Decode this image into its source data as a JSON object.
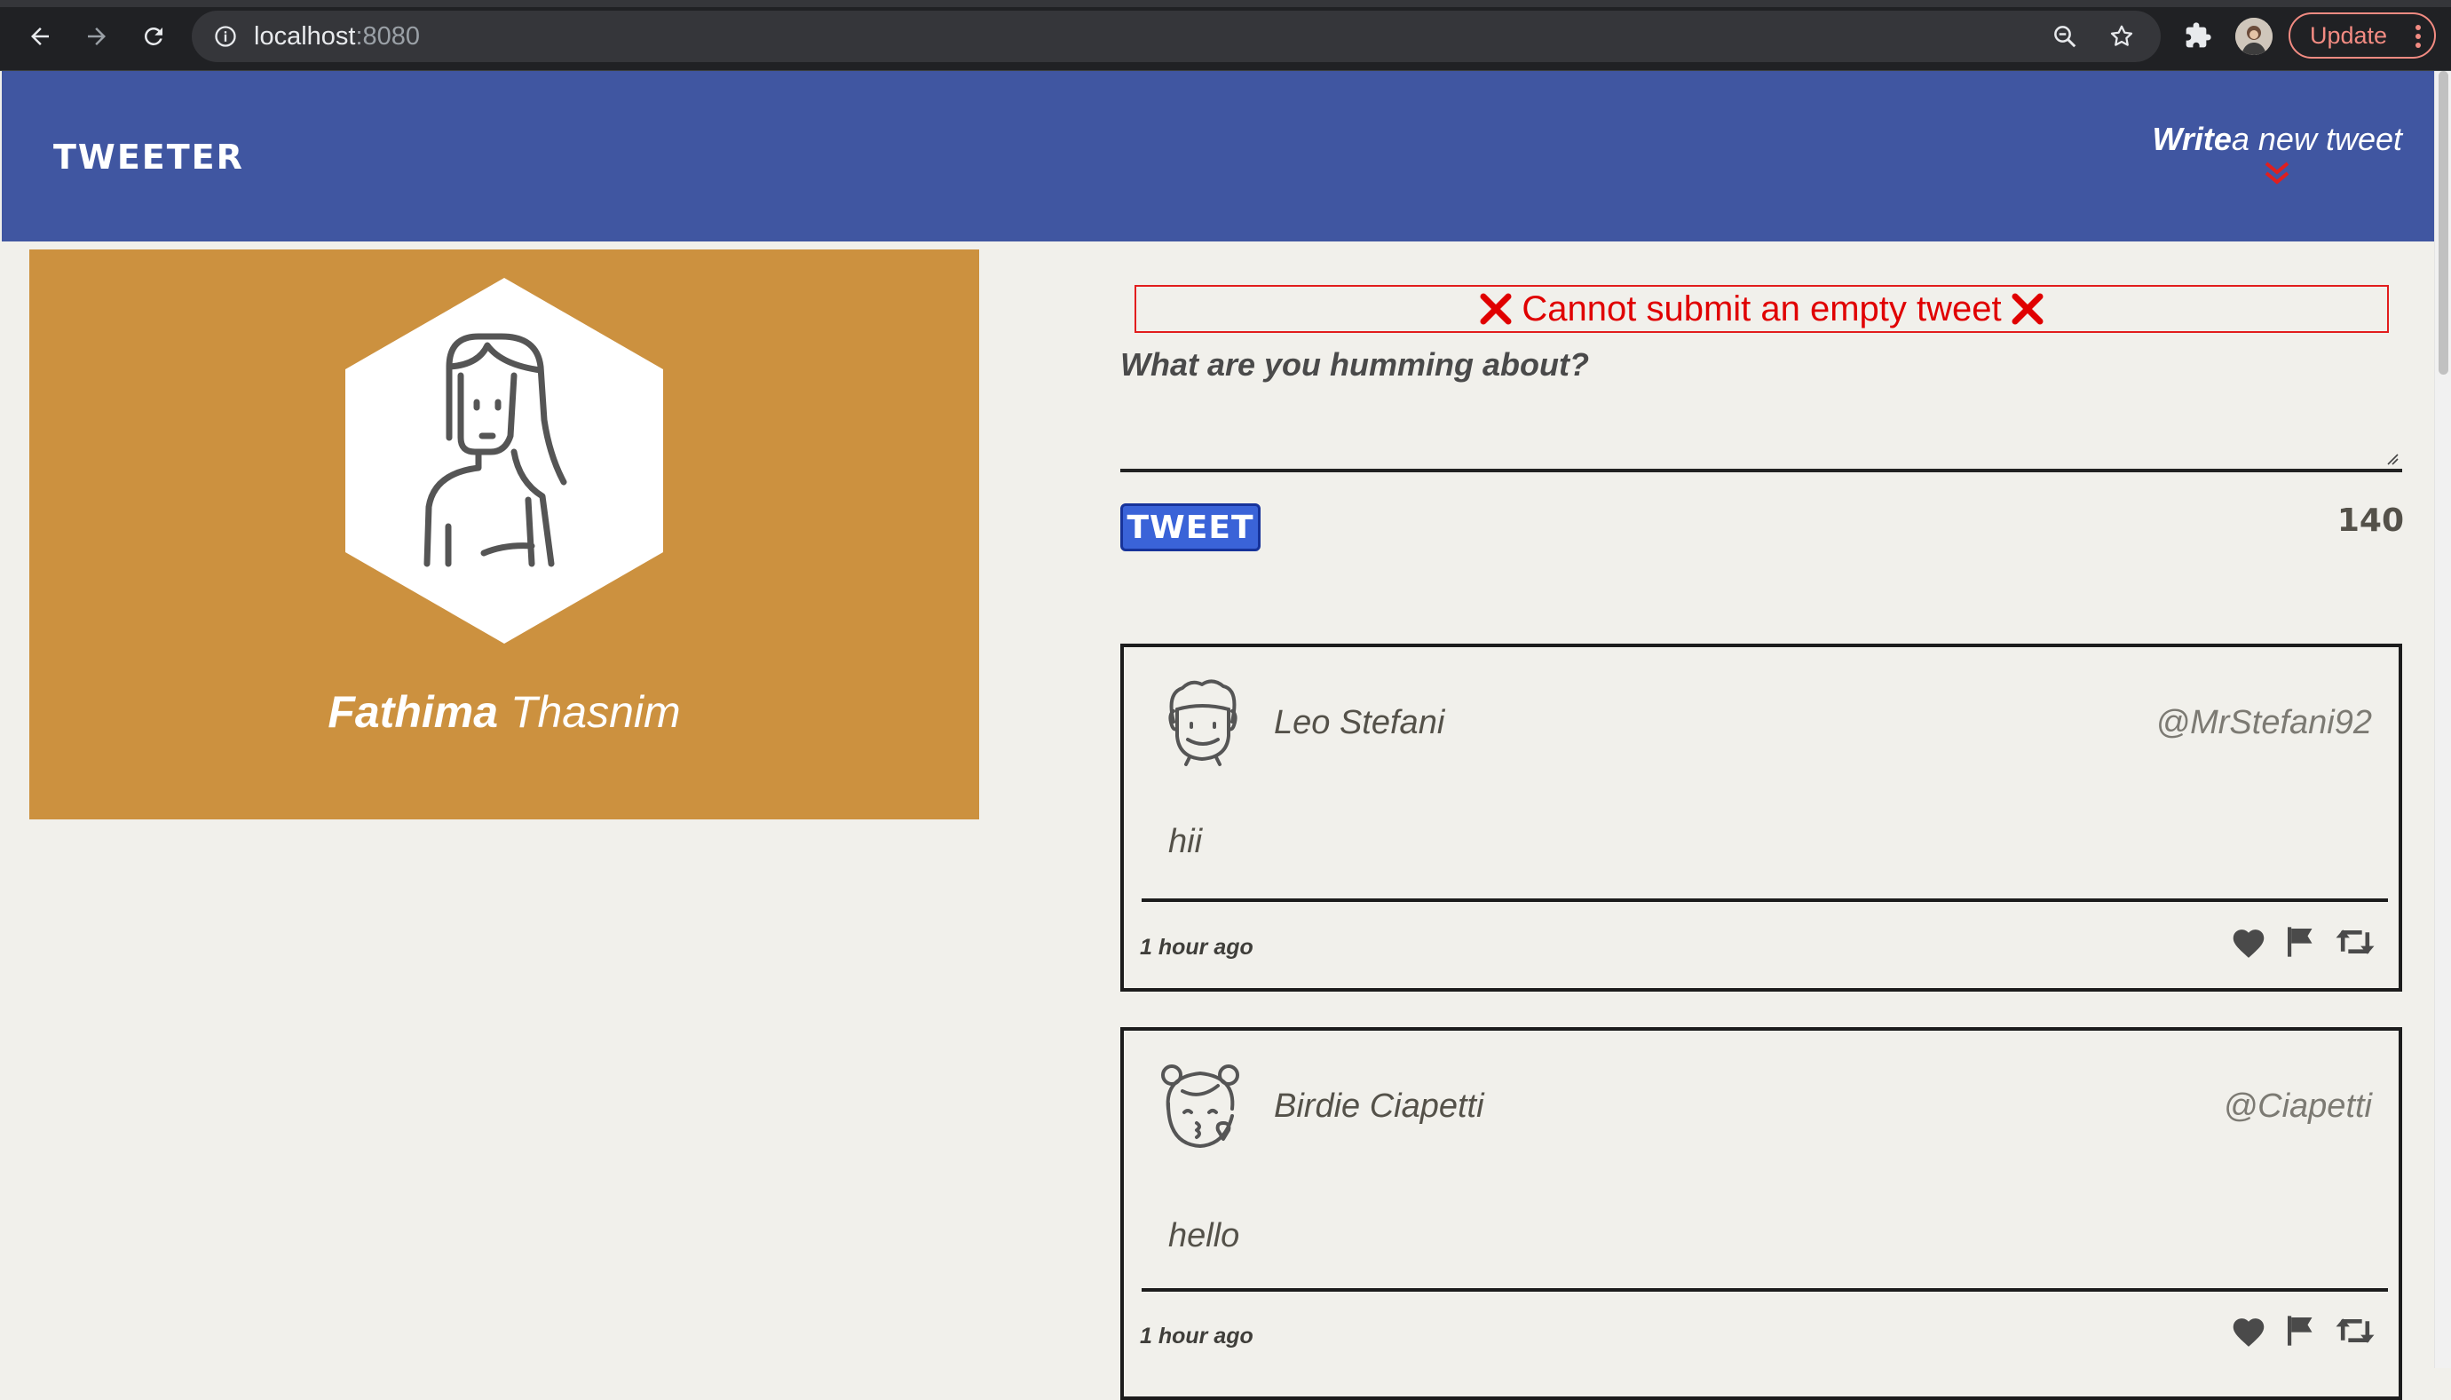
{
  "browser": {
    "url_host": "localhost",
    "url_port": ":8080",
    "update_label": "Update"
  },
  "header": {
    "brand": "TWEETER",
    "compose_bold": "Write",
    "compose_rest": "a new tweet"
  },
  "profile": {
    "first_name": "Fathima",
    "last_name": "Thasnim",
    "card_color": "#cc913f"
  },
  "compose": {
    "error": "Cannot submit an empty tweet",
    "prompt": "What are you humming about?",
    "input_value": "",
    "button_label": "TWEET",
    "char_counter": "140"
  },
  "tweets": [
    {
      "name": "Leo Stefani",
      "handle": "@MrStefani92",
      "body": "hii",
      "time": "1 hour ago",
      "avatar_icon": "boy-avatar-icon"
    },
    {
      "name": "Birdie Ciapetti",
      "handle": "@Ciapetti",
      "body": "hello",
      "time": "1 hour ago",
      "avatar_icon": "girl-avatar-icon"
    }
  ],
  "colors": {
    "header_bg": "#4056a1",
    "page_bg": "#f1f0eb",
    "error_red": "#e00000",
    "tweet_button": "#3a63d8"
  }
}
